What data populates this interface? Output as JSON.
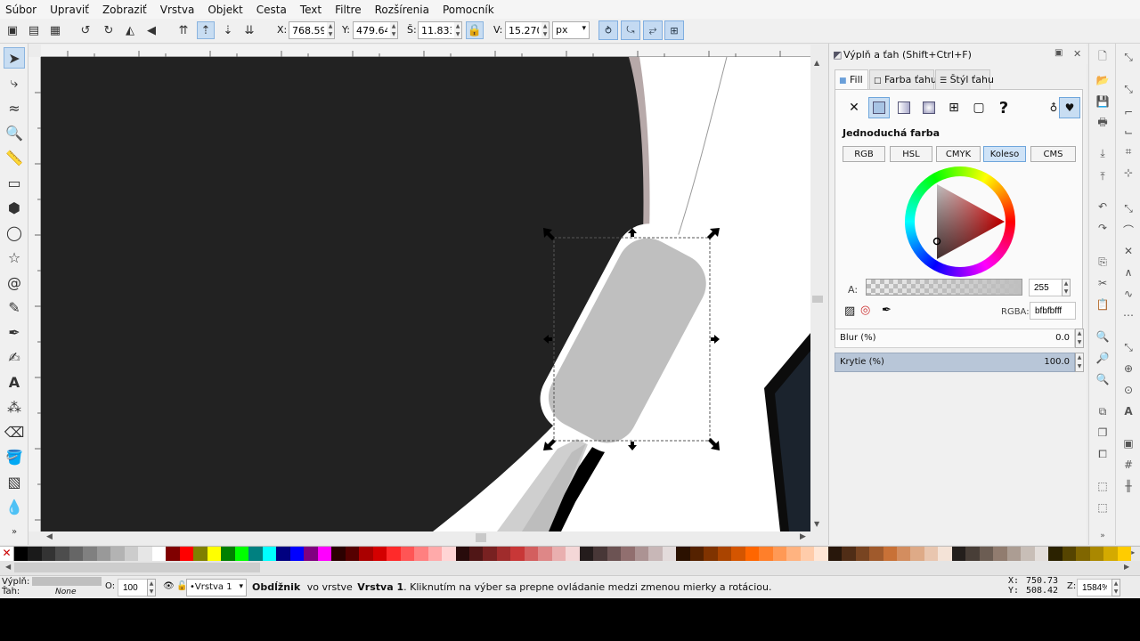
{
  "menu": [
    "Súbor",
    "Upraviť",
    "Zobraziť",
    "Vrstva",
    "Objekt",
    "Cesta",
    "Text",
    "Filtre",
    "Rozšírenia",
    "Pomocník"
  ],
  "toolbar": {
    "x_label": "X:",
    "x_value": "768.591",
    "y_label": "Y:",
    "y_value": "479.644",
    "w_label": "Š:",
    "w_value": "11.833",
    "h_label": "V:",
    "h_value": "15.270",
    "unit": "px"
  },
  "dock": {
    "title": "Výplň a ťah (Shift+Ctrl+F)",
    "tabs": [
      "Fill",
      "Farba ťahu",
      "Štýl ťahu"
    ],
    "fill_type_label": "Jednoduchá farba",
    "color_modes": [
      "RGB",
      "HSL",
      "CMYK",
      "Koleso",
      "CMS"
    ],
    "active_mode": "Koleso",
    "alpha_label": "A:",
    "alpha_value": "255",
    "rgba_label": "RGBA:",
    "rgba_value": "bfbfbfff",
    "blur_label": "Blur (%)",
    "blur_value": "0.0",
    "opacity_label": "Krytie (%)",
    "opacity_value": "100.0"
  },
  "status": {
    "fill_label": "Výplň:",
    "stroke_label": "Ťah:",
    "stroke_value": "None",
    "opacity_label": "O:",
    "opacity_value": "100",
    "layer_value": "•Vrstva 1",
    "msg_object": "Obdĺžnik",
    "msg_in_layer": "vo vrstve",
    "msg_layer": "Vrstva 1",
    "msg_text": ". Kliknutím na výber sa prepne ovládanie medzi zmenou mierky a rotáciou.",
    "cursor_x_label": "X:",
    "cursor_x": "750.73",
    "cursor_y_label": "Y:",
    "cursor_y": "508.42",
    "zoom_label": "Z:",
    "zoom_value": "1584%"
  },
  "colors": {
    "fill_swatch": "#bfbfbf",
    "selection_accent": "#c8ddf2"
  }
}
